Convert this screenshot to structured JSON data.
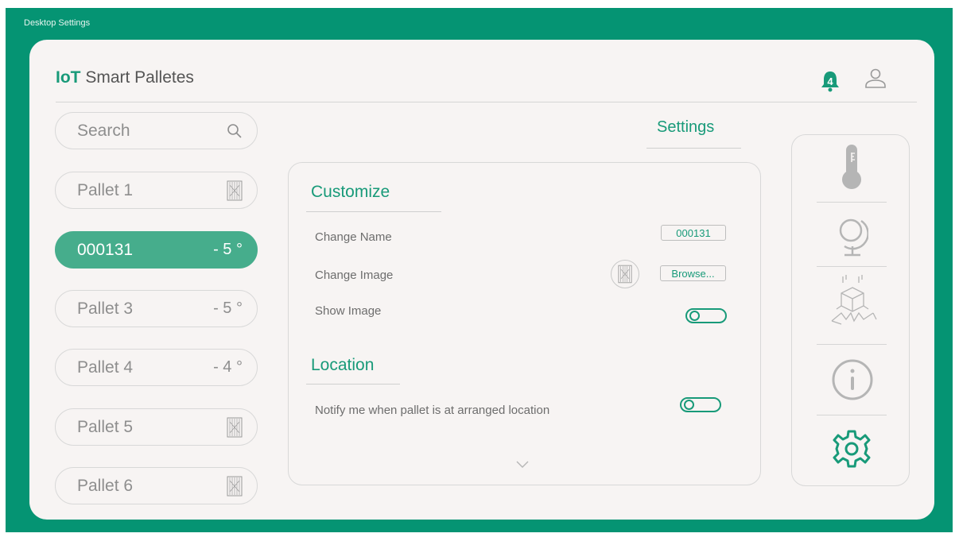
{
  "window": {
    "title": "Desktop Settings"
  },
  "header": {
    "brand_bold": "IoT",
    "brand_rest": " Smart Palletes",
    "notification_count": "4"
  },
  "search": {
    "placeholder": "Search"
  },
  "pallets": [
    {
      "name": "Pallet 1",
      "right": "",
      "icon": "pallet-icon"
    },
    {
      "name": "000131",
      "right": "- 5 °",
      "active": true
    },
    {
      "name": "Pallet 3",
      "right": "- 5 °"
    },
    {
      "name": "Pallet 4",
      "right": "- 4 °"
    },
    {
      "name": "Pallet 5",
      "right": "",
      "icon": "pallet-icon"
    },
    {
      "name": "Pallet 6",
      "right": "",
      "icon": "pallet-icon"
    }
  ],
  "settings": {
    "title": "Settings",
    "customize": {
      "title": "Customize",
      "change_name_label": "Change Name",
      "name_value": "000131",
      "change_image_label": "Change Image",
      "browse_label": "Browse...",
      "show_image_label": "Show Image"
    },
    "location": {
      "title": "Location",
      "notify_label": "Notify me when pallet is at arranged location"
    }
  },
  "sidebar": {
    "icons": [
      "thermometer-icon",
      "globe-icon",
      "broken-box-icon",
      "info-icon",
      "gear-icon"
    ]
  },
  "colors": {
    "accent": "#189a79",
    "frame": "#059473",
    "active_pill": "#46ad8c",
    "card": "#f7f4f3"
  }
}
